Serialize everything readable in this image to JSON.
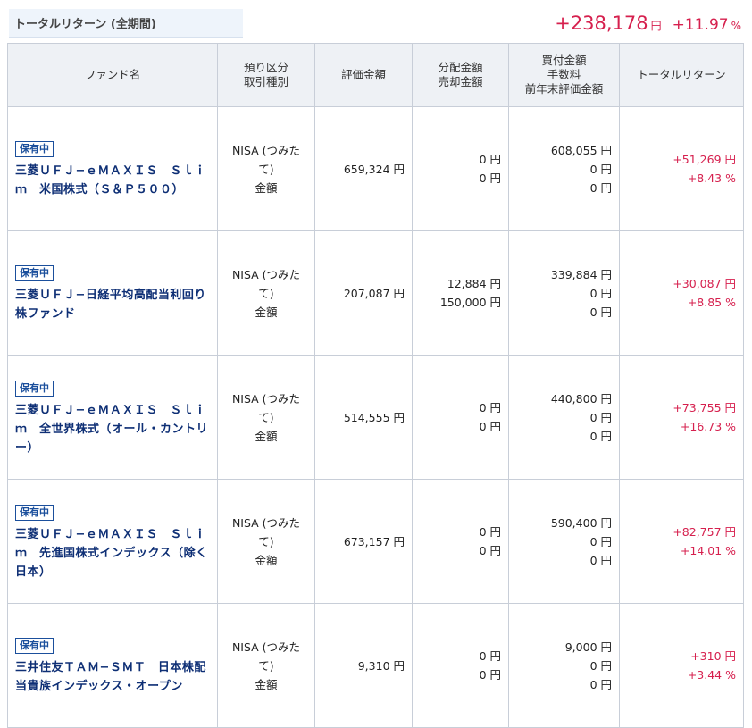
{
  "summary": {
    "label": "トータルリターン (全期間)",
    "amount": "+238,178",
    "amount_unit": "円",
    "percent": "+11.97",
    "percent_unit": "%"
  },
  "colors": {
    "positive": "#d6204e",
    "fund_name": "#0e2f75",
    "header_bg": "#eef1f5"
  },
  "headers": {
    "fund_name": "ファンド名",
    "account_l1": "預り区分",
    "account_l2": "取引種別",
    "valuation": "評価金額",
    "dist_l1": "分配金額",
    "dist_l2": "売却金額",
    "cost_l1": "買付金額",
    "cost_l2": "手数料",
    "cost_l3": "前年末評価金額",
    "total_return": "トータルリターン"
  },
  "funds": [
    {
      "status": "保有中",
      "name": "三菱ＵＦＪ−ｅＭＡＸＩＳ　Ｓｌｉｍ　米国株式（Ｓ＆Ｐ５００）",
      "account_l1": "NISA (つみた",
      "account_l2": "て)",
      "trade_type": "金額",
      "valuation": "659,324 円",
      "distribution": "0 円",
      "sale": "0 円",
      "purchase": "608,055 円",
      "fee": "0 円",
      "prev_year_val": "0 円",
      "return_amount": "+51,269 円",
      "return_pct": "+8.43 %"
    },
    {
      "status": "保有中",
      "name": "三菱ＵＦＪ−日経平均高配当利回り株ファンド",
      "account_l1": "NISA (つみた",
      "account_l2": "て)",
      "trade_type": "金額",
      "valuation": "207,087 円",
      "distribution": "12,884 円",
      "sale": "150,000 円",
      "purchase": "339,884 円",
      "fee": "0 円",
      "prev_year_val": "0 円",
      "return_amount": "+30,087 円",
      "return_pct": "+8.85 %"
    },
    {
      "status": "保有中",
      "name": "三菱ＵＦＪ−ｅＭＡＸＩＳ　Ｓｌｉｍ　全世界株式（オール・カントリー）",
      "account_l1": "NISA (つみた",
      "account_l2": "て)",
      "trade_type": "金額",
      "valuation": "514,555 円",
      "distribution": "0 円",
      "sale": "0 円",
      "purchase": "440,800 円",
      "fee": "0 円",
      "prev_year_val": "0 円",
      "return_amount": "+73,755 円",
      "return_pct": "+16.73 %"
    },
    {
      "status": "保有中",
      "name": "三菱ＵＦＪ−ｅＭＡＸＩＳ　Ｓｌｉｍ　先進国株式インデックス（除く日本）",
      "account_l1": "NISA (つみた",
      "account_l2": "て)",
      "trade_type": "金額",
      "valuation": "673,157 円",
      "distribution": "0 円",
      "sale": "0 円",
      "purchase": "590,400 円",
      "fee": "0 円",
      "prev_year_val": "0 円",
      "return_amount": "+82,757 円",
      "return_pct": "+14.01 %"
    },
    {
      "status": "保有中",
      "name": "三井住友ＴＡＭ−ＳＭＴ　日本株配当貴族インデックス・オープン",
      "account_l1": "NISA (つみた",
      "account_l2": "て)",
      "trade_type": "金額",
      "valuation": "9,310 円",
      "distribution": "0 円",
      "sale": "0 円",
      "purchase": "9,000 円",
      "fee": "0 円",
      "prev_year_val": "0 円",
      "return_amount": "+310 円",
      "return_pct": "+3.44 %"
    }
  ]
}
